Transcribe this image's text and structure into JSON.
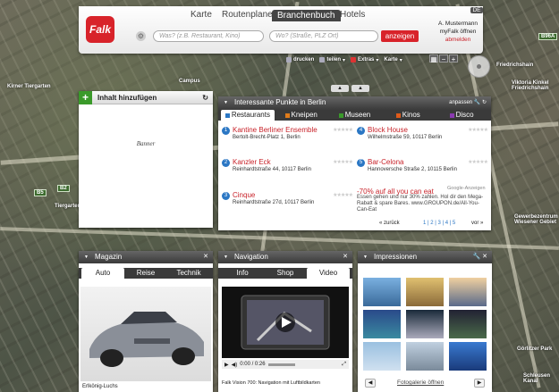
{
  "header": {
    "logo": "Falk",
    "nav": [
      "Karte",
      "Routenplaner",
      "Branchenbuch",
      "Hotels"
    ],
    "active_nav": "Branchenbuch",
    "what_placeholder": "Was? (z.B. Restaurant, Kino)",
    "where_placeholder": "Wo? (Straße, PLZ Ort)",
    "search_button": "anzeigen",
    "lang": "DE",
    "user": "A. Mustermann",
    "myfalk": "myFalk öffnen",
    "logout": "abmelden"
  },
  "toolbar": {
    "print": "drucken",
    "share": "teilen",
    "extras": "Extras",
    "map": "Karte"
  },
  "map_labels": [
    "Kirner Tiergarten",
    "Campus",
    "Friedrichshain",
    "Viktoria Kinkel Friedrichshain",
    "Tiergarten",
    "Gewerbezentrum Wiesener Gebiet",
    "Görlitzer Park",
    "Schleusen Kanal"
  ],
  "add_panel": {
    "label": "Inhalt hinzufügen",
    "banner": "Banner"
  },
  "poi": {
    "title": "Interessante Punkte in Berlin",
    "customize": "anpassen",
    "tabs": [
      "Restaurants",
      "Kneipen",
      "Museen",
      "Kinos",
      "Disco"
    ],
    "tab_colors": [
      "#2b77c4",
      "#e07b1a",
      "#3a9a2a",
      "#e05a1a",
      "#8a3ab0"
    ],
    "items": [
      {
        "n": "1",
        "name": "Kantine Berliner Ensemble",
        "addr": "Bertolt-Brecht-Platz 1, Berlin"
      },
      {
        "n": "4",
        "name": "Block House",
        "addr": "Wilhelmstraße 59, 10117 Berlin"
      },
      {
        "n": "2",
        "name": "Kanzler Eck",
        "addr": "Reinhardtstraße 44, 10117 Berlin"
      },
      {
        "n": "5",
        "name": "Bar-Celona",
        "addr": "Hannoversche Straße 2, 10115 Berlin"
      },
      {
        "n": "3",
        "name": "Cinque",
        "addr": "Reinhardtstraße 27d, 10117 Berlin"
      }
    ],
    "stars": "★★★★★",
    "ad_label": "Google-Anzeigen",
    "ad_head": "-70% auf all you can eat",
    "ad_text": "Essen gehen und nur 30% zahlen. Hol dir den Mega-Rabatt & spare Bares. www.GROUPON.de/All-You-Can-Eat",
    "back": "« zurück",
    "pages": "1 | 2 | 3 | 4 | 5",
    "next": "vor »"
  },
  "magazin": {
    "title": "Magazin",
    "tabs": [
      "Auto",
      "Reise",
      "Technik"
    ],
    "caption": "Erlkönig-Luchs"
  },
  "navigation": {
    "title": "Navigation",
    "tabs": [
      "Info",
      "Shop",
      "Video"
    ],
    "time": "0:00 / 0:26",
    "caption": "Falk Vision 700: Navigation mit Luftbildkarten"
  },
  "impressionen": {
    "title": "Impressionen",
    "link": "Fotogalerie öffnen"
  }
}
